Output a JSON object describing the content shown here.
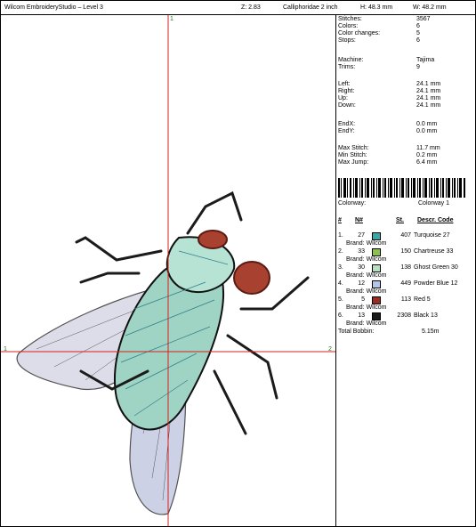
{
  "header": {
    "app_title": "Wilcom EmbroideryStudio – Level 3",
    "zoom": "Z: 2.83",
    "filename": "Calliphoridae 2 inch",
    "height": "H: 48.3 mm",
    "width": "W: 48.2 mm"
  },
  "canvas": {
    "label_top": "1",
    "label_left": "1",
    "label_right": "2"
  },
  "stats": {
    "stitches": {
      "label": "Stitches:",
      "value": "3567"
    },
    "colors": {
      "label": "Colors:",
      "value": "6"
    },
    "color_changes": {
      "label": "Color changes:",
      "value": "5"
    },
    "stops": {
      "label": "Stops:",
      "value": "6"
    },
    "machine": {
      "label": "Machine:",
      "value": "Tajima"
    },
    "trims": {
      "label": "Trims:",
      "value": "9"
    },
    "left": {
      "label": "Left:",
      "value": "24.1 mm"
    },
    "right": {
      "label": "Right:",
      "value": "24.1 mm"
    },
    "up": {
      "label": "Up:",
      "value": "24.1 mm"
    },
    "down": {
      "label": "Down:",
      "value": "24.1 mm"
    },
    "endx": {
      "label": "EndX:",
      "value": "0.0 mm"
    },
    "endy": {
      "label": "EndY:",
      "value": "0.0 mm"
    },
    "max_stitch": {
      "label": "Max Stitch:",
      "value": "11.7 mm"
    },
    "min_stitch": {
      "label": "Min Stitch:",
      "value": "0.2 mm"
    },
    "max_jump": {
      "label": "Max Jump:",
      "value": "6.4 mm"
    }
  },
  "colorway": {
    "label": "Colorway:",
    "value": "Colorway 1"
  },
  "table_headers": {
    "index": "#",
    "number": "N#",
    "stitches": "St.",
    "description": "Descr. Code"
  },
  "threads": [
    {
      "index": "1.",
      "number": "27",
      "color": "#3aa6a6",
      "stitches": "407",
      "description": "Turquoise 27",
      "brand": "Brand: Wilcom"
    },
    {
      "index": "2.",
      "number": "33",
      "color": "#8bc34a",
      "stitches": "150",
      "description": "Chartreuse 33",
      "brand": "Brand: Wilcom"
    },
    {
      "index": "3.",
      "number": "30",
      "color": "#b8e0c0",
      "stitches": "138",
      "description": "Ghost Green 30",
      "brand": "Brand: Wilcom"
    },
    {
      "index": "4.",
      "number": "12",
      "color": "#b8c4e8",
      "stitches": "449",
      "description": "Powder Blue 12",
      "brand": "Brand: Wilcom"
    },
    {
      "index": "5.",
      "number": "5",
      "color": "#9b2a22",
      "stitches": "113",
      "description": "Red 5",
      "brand": "Brand: Wilcom"
    },
    {
      "index": "6.",
      "number": "13",
      "color": "#1a1a1a",
      "stitches": "2308",
      "description": "Black 13",
      "brand": "Brand: Wilcom"
    }
  ],
  "total_bobbin": {
    "label": "Total Bobbin:",
    "value": "5.15m"
  }
}
